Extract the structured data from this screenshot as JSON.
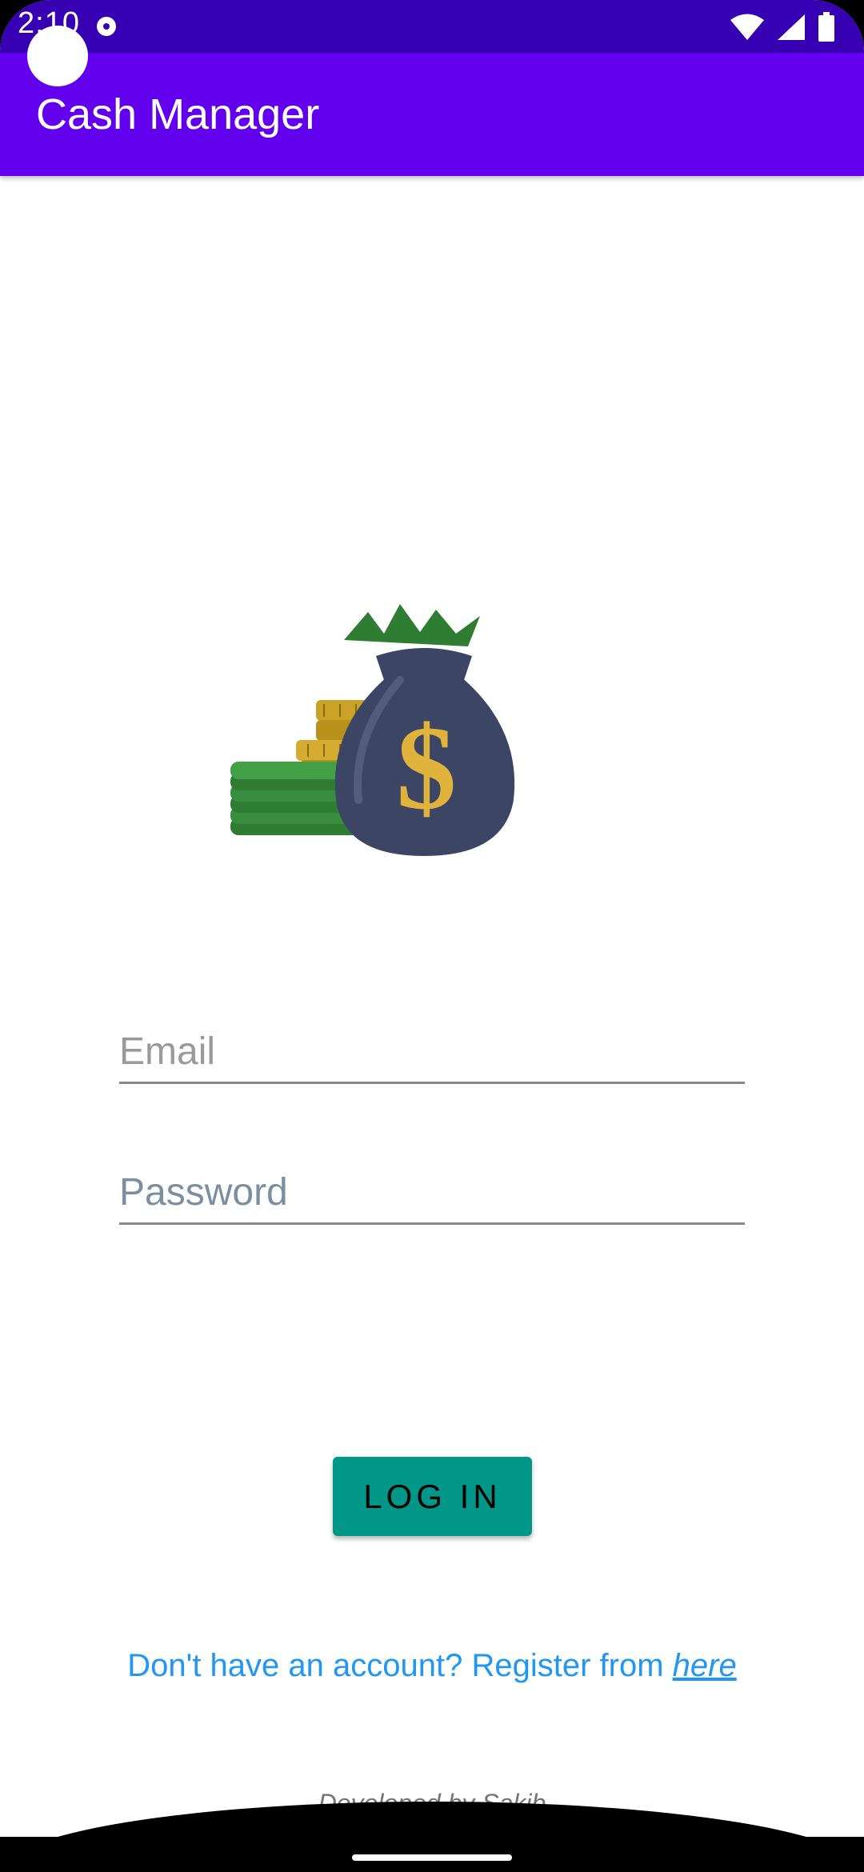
{
  "status_bar": {
    "time": "2:10",
    "icons": [
      "notification-icon",
      "wifi-icon",
      "signal-icon",
      "battery-icon"
    ]
  },
  "app_bar": {
    "title": "Cash Manager"
  },
  "illustration": {
    "icon": "money-bag-icon"
  },
  "form": {
    "email_placeholder": "Email",
    "email_value": "",
    "password_placeholder": "Password",
    "password_value": "",
    "login_label": "LOG IN"
  },
  "footer": {
    "register_prefix": "Don't have an account? Register from ",
    "register_link": "here",
    "credit": "Developed by Sakib"
  },
  "colors": {
    "status_bar": "#3700b3",
    "app_bar": "#6200ee",
    "button": "#009688",
    "link": "#2196f3"
  }
}
